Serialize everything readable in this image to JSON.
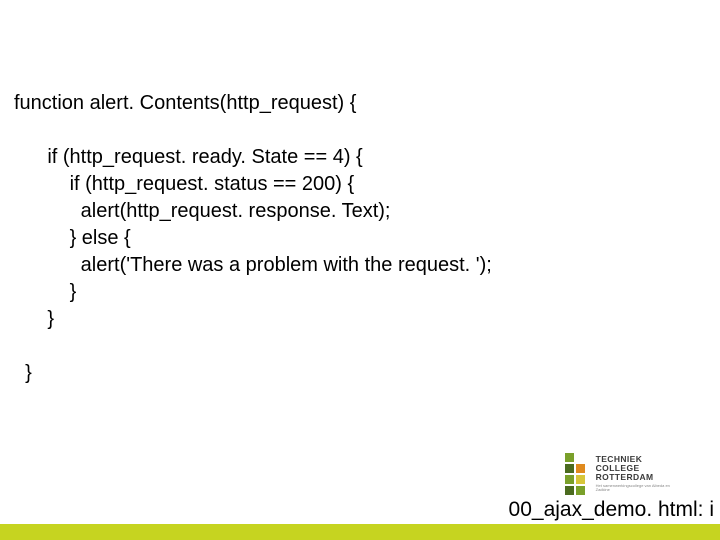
{
  "code": {
    "l1": "function alert. Contents(http_request) {",
    "l2": "",
    "l3": "      if (http_request. ready. State == 4) {",
    "l4": "          if (http_request. status == 200) {",
    "l5": "            alert(http_request. response. Text);",
    "l6": "          } else {",
    "l7": "            alert('There was a problem with the request. ');",
    "l8": "          }",
    "l9": "      }",
    "l10": "",
    "l11": "  }"
  },
  "footer": {
    "label": "00_ajax_demo. html: i"
  },
  "logo": {
    "line1": "TECHNIEK",
    "line2": "COLLEGE",
    "line3": "ROTTERDAM",
    "sub": "Het samenwerkingscollege van Albeda en Zadkine"
  }
}
